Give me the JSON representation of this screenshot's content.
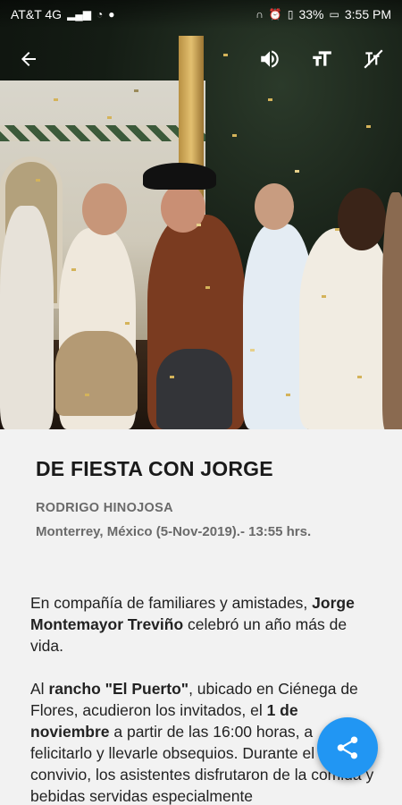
{
  "status_bar": {
    "carrier": "AT&T 4G",
    "battery": "33%",
    "time": "3:55 PM"
  },
  "toolbar": {
    "back_icon": "arrow-left-icon",
    "audio_icon": "volume-icon",
    "text_size_icon": "text-size-icon",
    "format_icon": "text-format-off-icon"
  },
  "article": {
    "headline": "DE FIESTA CON JORGE",
    "author": "RODRIGO HINOJOSA",
    "dateline": "Monterrey, México (5-Nov-2019).- 13:55 hrs.",
    "p1_a": "En compañía de familiares y amistades, ",
    "p1_b": "Jorge Montemayor Treviño",
    "p1_c": " celebró un año más de vida.",
    "p2_a": "Al ",
    "p2_b": "rancho \"El Puerto\"",
    "p2_c": ", ubicado en Ciénega de Flores, acudieron los invitados, el ",
    "p2_d": "1 de noviembre",
    "p2_e": " a partir de las 16:00 horas, a felicitarlo y llevarle obsequios. Durante el convivio, los asistentes disfrutaron de la comida y bebidas servidas especialmente"
  },
  "share_button": {
    "icon": "share-icon",
    "color": "#2196f3"
  }
}
